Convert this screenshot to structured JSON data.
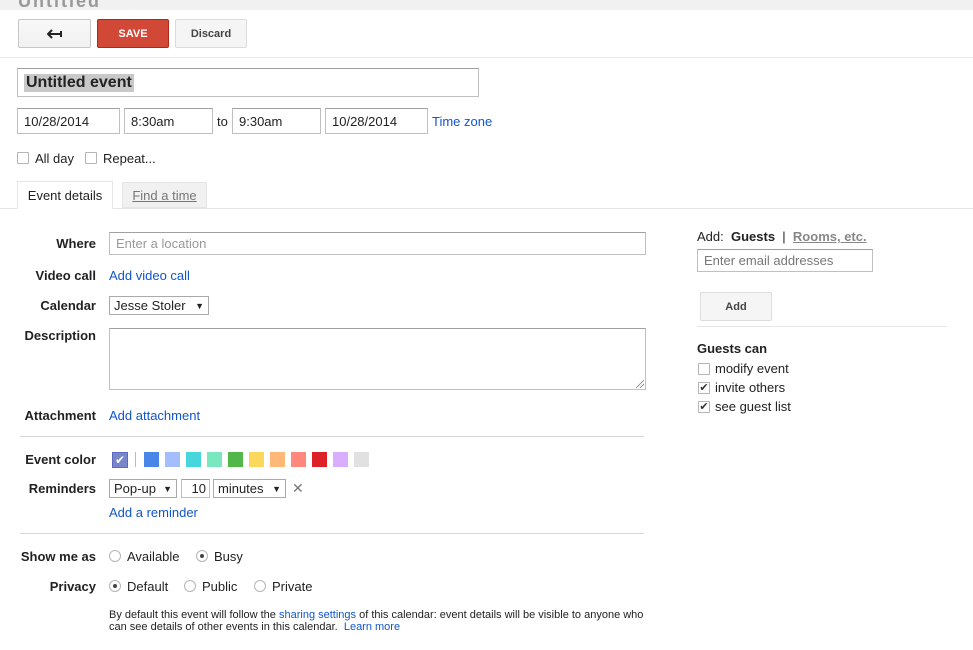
{
  "header": {
    "partial_title": "Untitled"
  },
  "toolbar": {
    "back_icon": "back-arrow-icon",
    "save_label": "SAVE",
    "discard_label": "Discard"
  },
  "event": {
    "title": "Untitled event",
    "start_date": "10/28/2014",
    "start_time": "8:30am",
    "to_label": "to",
    "end_time": "9:30am",
    "end_date": "10/28/2014",
    "timezone_label": "Time zone",
    "all_day_label": "All day",
    "repeat_label": "Repeat..."
  },
  "tabs": [
    {
      "label": "Event details",
      "active": true
    },
    {
      "label": "Find a time",
      "active": false
    }
  ],
  "details": {
    "where_label": "Where",
    "where_placeholder": "Enter a location",
    "video_label": "Video call",
    "video_link": "Add video call",
    "calendar_label": "Calendar",
    "calendar_value": "Jesse Stoler",
    "description_label": "Description",
    "attachment_label": "Attachment",
    "attachment_link": "Add attachment",
    "color_label": "Event color",
    "colors": [
      "#7986cb",
      "#4986e7",
      "#a4bdfc",
      "#46d6db",
      "#7ae7bf",
      "#51b749",
      "#fbd75b",
      "#ffb878",
      "#ff887c",
      "#dc2127",
      "#dbadff",
      "#e1e1e1"
    ],
    "reminders_label": "Reminders",
    "reminder_type": "Pop-up",
    "reminder_amount": "10",
    "reminder_unit": "minutes",
    "add_reminder_link": "Add a reminder",
    "show_me_as_label": "Show me as",
    "available_label": "Available",
    "busy_label": "Busy",
    "privacy_label": "Privacy",
    "privacy_default": "Default",
    "privacy_public": "Public",
    "privacy_private": "Private",
    "privacy_note_1": "By default this event will follow the ",
    "sharing_link": "sharing settings",
    "privacy_note_2": " of this calendar: event details will be visible to anyone who",
    "privacy_note_3": "can see details of other events in this calendar.",
    "learn_more": "Learn more"
  },
  "guests": {
    "add_label": "Add:",
    "guests_tab": "Guests",
    "separator": "|",
    "rooms_tab": "Rooms, etc.",
    "email_placeholder": "Enter email addresses",
    "add_button": "Add",
    "guests_can_label": "Guests can",
    "modify_label": "modify event",
    "invite_label": "invite others",
    "see_list_label": "see guest list"
  }
}
